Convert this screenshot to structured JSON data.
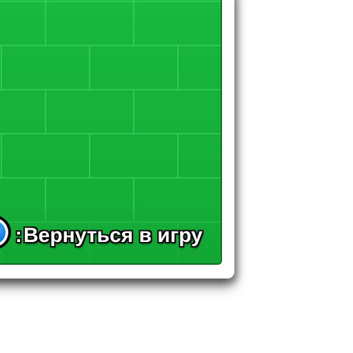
{
  "theme": {
    "panel_color": "#15b43a",
    "panel_border": "#0e6a25",
    "mortar_color": "#3ed862",
    "button_color": "#1177e6"
  },
  "hint": {
    "button_icon": "blue-round-button-icon",
    "separator": ":",
    "label": "Вернуться в игру"
  }
}
